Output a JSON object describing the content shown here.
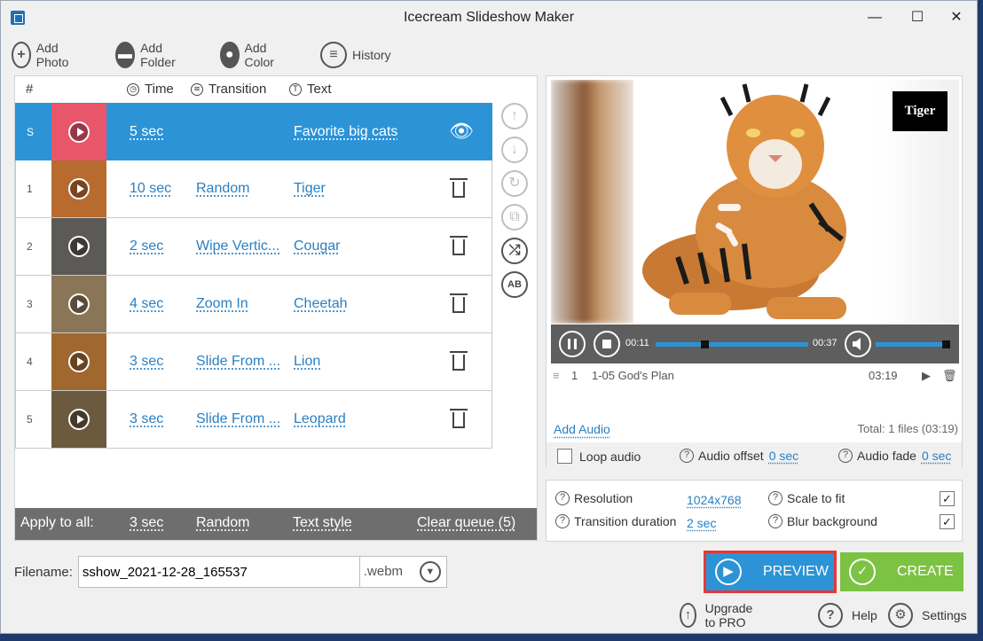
{
  "window": {
    "title": "Icecream Slideshow Maker",
    "controls": {
      "minimize": "—",
      "maximize": "☐",
      "close": "✕"
    }
  },
  "toolbar": {
    "add_photo": "Add Photo",
    "add_folder": "Add Folder",
    "add_color": "Add Color",
    "history": "History"
  },
  "list": {
    "headers": {
      "num": "#",
      "time": "Time",
      "transition": "Transition",
      "text": "Text"
    },
    "rows": [
      {
        "num": "S",
        "time": "5 sec",
        "transition": "",
        "text": "Favorite big cats",
        "selected": true,
        "thumb_color": "#e8566a"
      },
      {
        "num": "1",
        "time": "10 sec",
        "transition": "Random",
        "text": "Tiger",
        "selected": false,
        "thumb_color": "#b86b2e"
      },
      {
        "num": "2",
        "time": "2 sec",
        "transition": "Wipe Vertic...",
        "text": "Cougar",
        "selected": false,
        "thumb_color": "#5c5a57"
      },
      {
        "num": "3",
        "time": "4 sec",
        "transition": "Zoom In",
        "text": "Cheetah",
        "selected": false,
        "thumb_color": "#8a7656"
      },
      {
        "num": "4",
        "time": "3 sec",
        "transition": "Slide From ...",
        "text": "Lion",
        "selected": false,
        "thumb_color": "#a0672f"
      },
      {
        "num": "5",
        "time": "3 sec",
        "transition": "Slide From ...",
        "text": "Leopard",
        "selected": false,
        "thumb_color": "#6b5a3e"
      }
    ],
    "apply_bar": {
      "label": "Apply to all:",
      "time": "3 sec",
      "transition": "Random",
      "text_style": "Text style",
      "clear_queue": "Clear queue (5)"
    }
  },
  "filename": {
    "label": "Filename:",
    "value": "sshow_2021-12-28_165537",
    "extension": ".webm"
  },
  "preview": {
    "slide_label": "Tiger",
    "player": {
      "current_time": "00:11",
      "total_time": "00:37",
      "progress": 0.32,
      "volume": 1.0
    },
    "audio_track": {
      "index": "1",
      "name": "1-05 God's Plan",
      "duration": "03:19"
    },
    "add_audio": "Add Audio",
    "total": "Total: 1 files (03:19)",
    "loop_audio": "Loop audio",
    "audio_offset_label": "Audio offset",
    "audio_offset_value": "0 sec",
    "audio_fade_label": "Audio fade",
    "audio_fade_value": "0 sec"
  },
  "settings": {
    "resolution_label": "Resolution",
    "resolution_value": "1024x768",
    "transition_duration_label": "Transition duration",
    "transition_duration_value": "2 sec",
    "scale_to_fit_label": "Scale to fit",
    "blur_background_label": "Blur background",
    "scale_to_fit_checked": true,
    "blur_background_checked": true
  },
  "actions": {
    "preview": "PREVIEW",
    "create": "CREATE"
  },
  "footer": {
    "upgrade": "Upgrade to PRO",
    "help": "Help",
    "settings": "Settings"
  },
  "colors": {
    "accent_blue": "#2c93d6",
    "create_green": "#7cc243",
    "highlight_red": "#e53935"
  }
}
